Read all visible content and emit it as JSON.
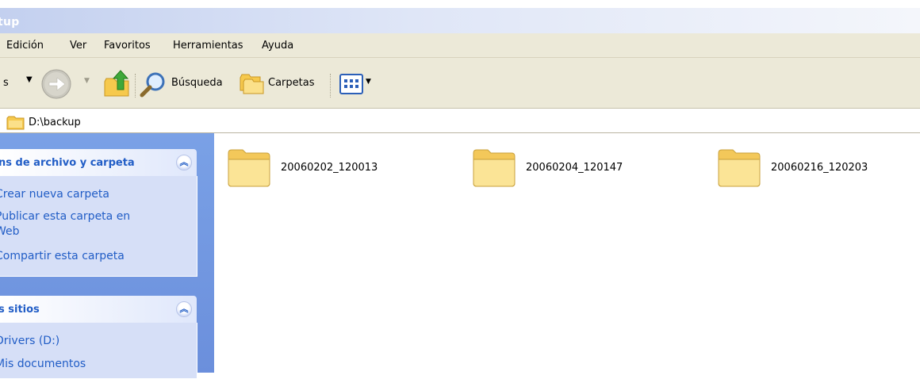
{
  "window": {
    "title": "tup"
  },
  "menu": {
    "items": [
      "Edición",
      "Ver",
      "Favoritos",
      "Herramientas",
      "Ayuda"
    ]
  },
  "toolbar": {
    "back_label": "s",
    "search_label": "Búsqueda",
    "folders_label": "Carpetas"
  },
  "address": {
    "path": "D:\\backup"
  },
  "tasks_panel": {
    "title": "ns de archivo y carpeta",
    "links": [
      "Crear nueva carpeta",
      "Publicar esta carpeta en",
      "Web",
      "Compartir esta carpeta"
    ]
  },
  "places_panel": {
    "title": "s sitios",
    "links": [
      "Drivers (D:)",
      "Mis documentos"
    ]
  },
  "folders": [
    "20060202_120013",
    "20060204_120147",
    "20060216_120203"
  ],
  "colors": {
    "link": "#215dc6",
    "pane": "#7aa1e6",
    "folder": "#f8d56a"
  }
}
